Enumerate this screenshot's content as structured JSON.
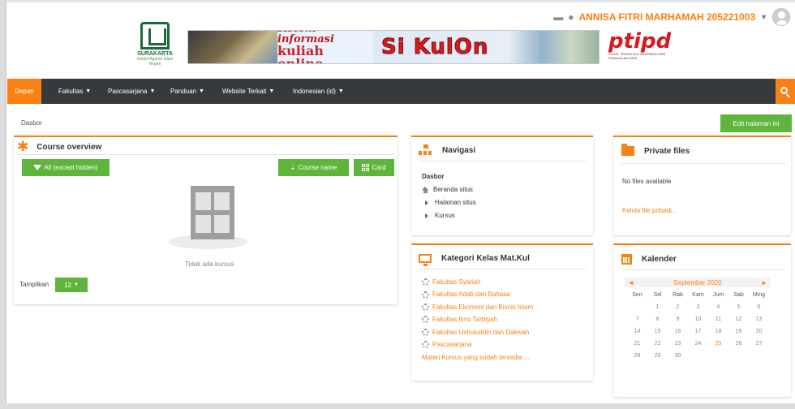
{
  "header": {
    "username": "ANNISA FITRI MARHAMAH 205221003",
    "logo_text": "SURAKARTA",
    "logo_sub": "Institut Agama Islam Negeri",
    "banner_line1": "sistem informasi",
    "banner_line2": "kuliah online",
    "banner_brand": "Si KulOn",
    "ptipd_text": "ptipd",
    "ptipd_sub": "PUSAT TEKNOLOGI INFORMASI DAN PANGKALAN DATA"
  },
  "navbar": {
    "home": "Depan",
    "items": [
      {
        "label": "Fakultas"
      },
      {
        "label": "Pascasarjana"
      },
      {
        "label": "Panduan"
      },
      {
        "label": "Website Terkait"
      },
      {
        "label": "Indonesian (id)"
      }
    ]
  },
  "breadcrumb": "Dasbor",
  "edit_button": "Edit halaman ini",
  "course_overview": {
    "title": "Course overview",
    "filter": "All (except hidden)",
    "sort": "Course name",
    "view": "Card",
    "empty_text": "Tidak ada kursus",
    "show_label": "Tampilkan",
    "show_value": "12"
  },
  "navigasi": {
    "title": "Navigasi",
    "root": "Dasbor",
    "items": [
      "Beranda situs",
      "Halaman situs",
      "Kursus"
    ]
  },
  "kategori": {
    "title": "Kategori Kelas Mat.Kul",
    "items": [
      "Fakultas Syariah",
      "Fakultas Adab dan Bahasa",
      "Fakultas Ekonomi dan Bisnis Islam",
      "Fakultas Ilmu Tarbiyah",
      "Fakultas Ushuluddin dan Dakwah",
      "Pascasarjana"
    ],
    "more": "Materi Kursus yang sudah tersedia ..."
  },
  "private_files": {
    "title": "Private files",
    "empty": "No files available",
    "manage": "Kelola file pribadi..."
  },
  "kalender": {
    "title": "Kalender",
    "prev": "◄",
    "month": "September 2020",
    "next": "►",
    "days": [
      "Sen",
      "Sel",
      "Rab",
      "Kam",
      "Jum",
      "Sab",
      "Ming"
    ],
    "weeks": [
      [
        "",
        "1",
        "2",
        "3",
        "4",
        "5",
        "6"
      ],
      [
        "7",
        "8",
        "9",
        "10",
        "11",
        "12",
        "13"
      ],
      [
        "14",
        "15",
        "16",
        "17",
        "18",
        "19",
        "20"
      ],
      [
        "21",
        "22",
        "23",
        "24",
        "25",
        "26",
        "27"
      ],
      [
        "28",
        "29",
        "30",
        "",
        "",
        "",
        ""
      ]
    ],
    "today": "25"
  },
  "colors": {
    "accent": "#f98012",
    "success": "#5fb53c",
    "navbar": "#373a3c"
  },
  "icons": [
    "message-icon",
    "notification-icon",
    "avatar",
    "search-icon",
    "asterisk-icon",
    "filter-icon",
    "sort-icon",
    "grid-icon",
    "sitemap-icon",
    "folder-icon",
    "monitor-icon",
    "calendar-icon",
    "home-icon",
    "gear-icon"
  ]
}
